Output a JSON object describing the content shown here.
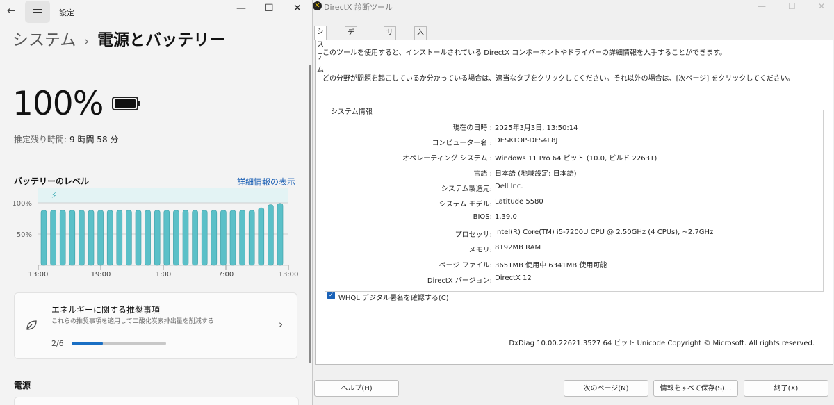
{
  "settings": {
    "window_title": "設定",
    "breadcrumb_parent": "システム",
    "breadcrumb_sep": "›",
    "page_title": "電源とバッテリー",
    "battery_percent": "100%",
    "remaining_label": "推定残り時間:",
    "remaining_value": "9 時間 58 分",
    "battery_level_label": "バッテリーのレベル",
    "details_link": "詳細情報の表示",
    "recommend_title": "エネルギーに関する推奨事項",
    "recommend_subtitle": "これらの推奨事項を適用して二酸化炭素排出量を削減する",
    "recommend_count": "2/6",
    "recommend_progress": 0.33,
    "power_section": "電源"
  },
  "chart_data": {
    "type": "bar",
    "title": "バッテリーのレベル",
    "x_tick_labels": [
      "13:00",
      "19:00",
      "1:00",
      "7:00",
      "13:00"
    ],
    "y_tick_labels": [
      "100%",
      "50%"
    ],
    "ylim": [
      0,
      100
    ],
    "values": [
      88,
      88,
      88,
      88,
      88,
      88,
      88,
      88,
      88,
      88,
      88,
      88,
      88,
      88,
      88,
      88,
      88,
      88,
      88,
      88,
      88,
      88,
      88,
      92,
      97,
      99
    ],
    "charging_marker": "⚡",
    "bar_color": "#5bc0c8"
  },
  "dxdiag": {
    "window_title": "DirectX 診断ツール",
    "tabs": [
      "システム",
      "ディスプレイ",
      "サウンド",
      "入力"
    ],
    "intro1": "このツールを使用すると、インストールされている DirectX コンポーネントやドライバーの詳細情報を入手することができます。",
    "intro2": "どの分野が問題を起こしているか分かっている場合は、適当なタブをクリックしてください。それ以外の場合は、[次ページ] をクリックしてください。",
    "group_label": "システム情報",
    "info_rows": [
      {
        "key": "現在の日時 :",
        "value": "2025年3月3日, 13:50:14"
      },
      {
        "key": "コンピューター名 :",
        "value": "DESKTOP-DFS4L8J"
      },
      {
        "key": "オペレーティング システム :",
        "value": "Windows 11 Pro 64 ビット (10.0, ビルド 22631)"
      },
      {
        "key": "言語 :",
        "value": "日本語 (地域設定: 日本語)"
      },
      {
        "key": "システム製造元:",
        "value": "Dell Inc."
      },
      {
        "key": "システム モデル:",
        "value": "Latitude 5580"
      },
      {
        "key": "BIOS:",
        "value": "1.39.0"
      },
      {
        "key": "プロセッサ:",
        "value": "Intel(R) Core(TM) i5-7200U CPU @ 2.50GHz (4 CPUs), ~2.7GHz"
      },
      {
        "key": "メモリ:",
        "value": "8192MB RAM"
      },
      {
        "key": "ページ ファイル:",
        "value": "3651MB 使用中 6341MB 使用可能"
      },
      {
        "key": "DirectX バージョン:",
        "value": "DirectX 12"
      }
    ],
    "whql_label": "WHQL デジタル署名を確認する(C)",
    "version_line": "DxDiag 10.00.22621.3527 64 ビット Unicode  Copyright © Microsoft. All rights reserved.",
    "buttons": {
      "help": "ヘルプ(H)",
      "next": "次のページ(N)",
      "save": "情報をすべて保存(S)...",
      "exit": "終了(X)"
    }
  }
}
